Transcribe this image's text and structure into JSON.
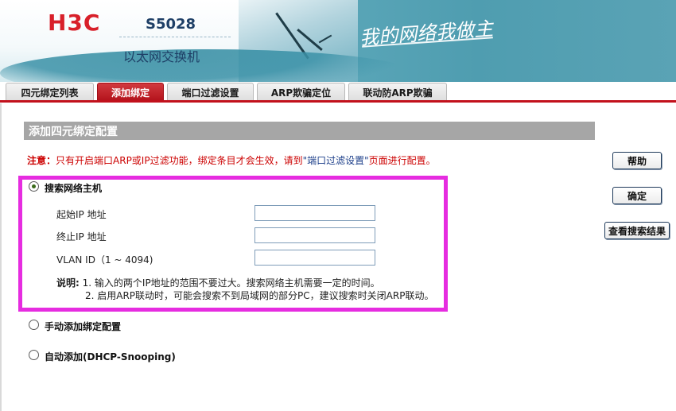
{
  "header": {
    "logo": "H3C",
    "model": "S5028",
    "subtitle": "以太网交换机",
    "slogan": "我的网络我做主"
  },
  "tabs": [
    {
      "label": "四元绑定列表",
      "active": false
    },
    {
      "label": "添加绑定",
      "active": true
    },
    {
      "label": "端口过滤设置",
      "active": false
    },
    {
      "label": "ARP欺骗定位",
      "active": false
    },
    {
      "label": "联动防ARP欺骗",
      "active": false
    }
  ],
  "section": {
    "title": "添加四元绑定配置"
  },
  "notice": {
    "label": "注意：",
    "text1": "只有开启端口ARP或IP过滤功能，绑定条目才会生效，请到",
    "link": "\"端口过滤设置\"",
    "text2": "页面进行配置。"
  },
  "options": {
    "search": {
      "label": "搜索网络主机",
      "checked": true
    },
    "manual": {
      "label": "手动添加绑定配置",
      "checked": false
    },
    "auto": {
      "label": "自动添加(DHCP-Snooping)",
      "checked": false
    }
  },
  "fields": {
    "start_ip": {
      "label": "起始IP 地址",
      "value": ""
    },
    "end_ip": {
      "label": "终止IP 地址",
      "value": ""
    },
    "vlan": {
      "label": "VLAN ID（1 ~ 4094)",
      "value": ""
    }
  },
  "description": {
    "label": "说明:",
    "line1": "1. 输入的两个IP地址的范围不要过大。搜索网络主机需要一定的时间。",
    "line2": "2. 启用ARP联动时，可能会搜索不到局域网的部分PC，建议搜索时关闭ARP联动。"
  },
  "buttons": {
    "help": "帮助",
    "ok": "确定",
    "view_results": "查看搜索结果"
  },
  "colors": {
    "accent_red": "#c2111c",
    "highlight_magenta": "#e62ce0"
  }
}
